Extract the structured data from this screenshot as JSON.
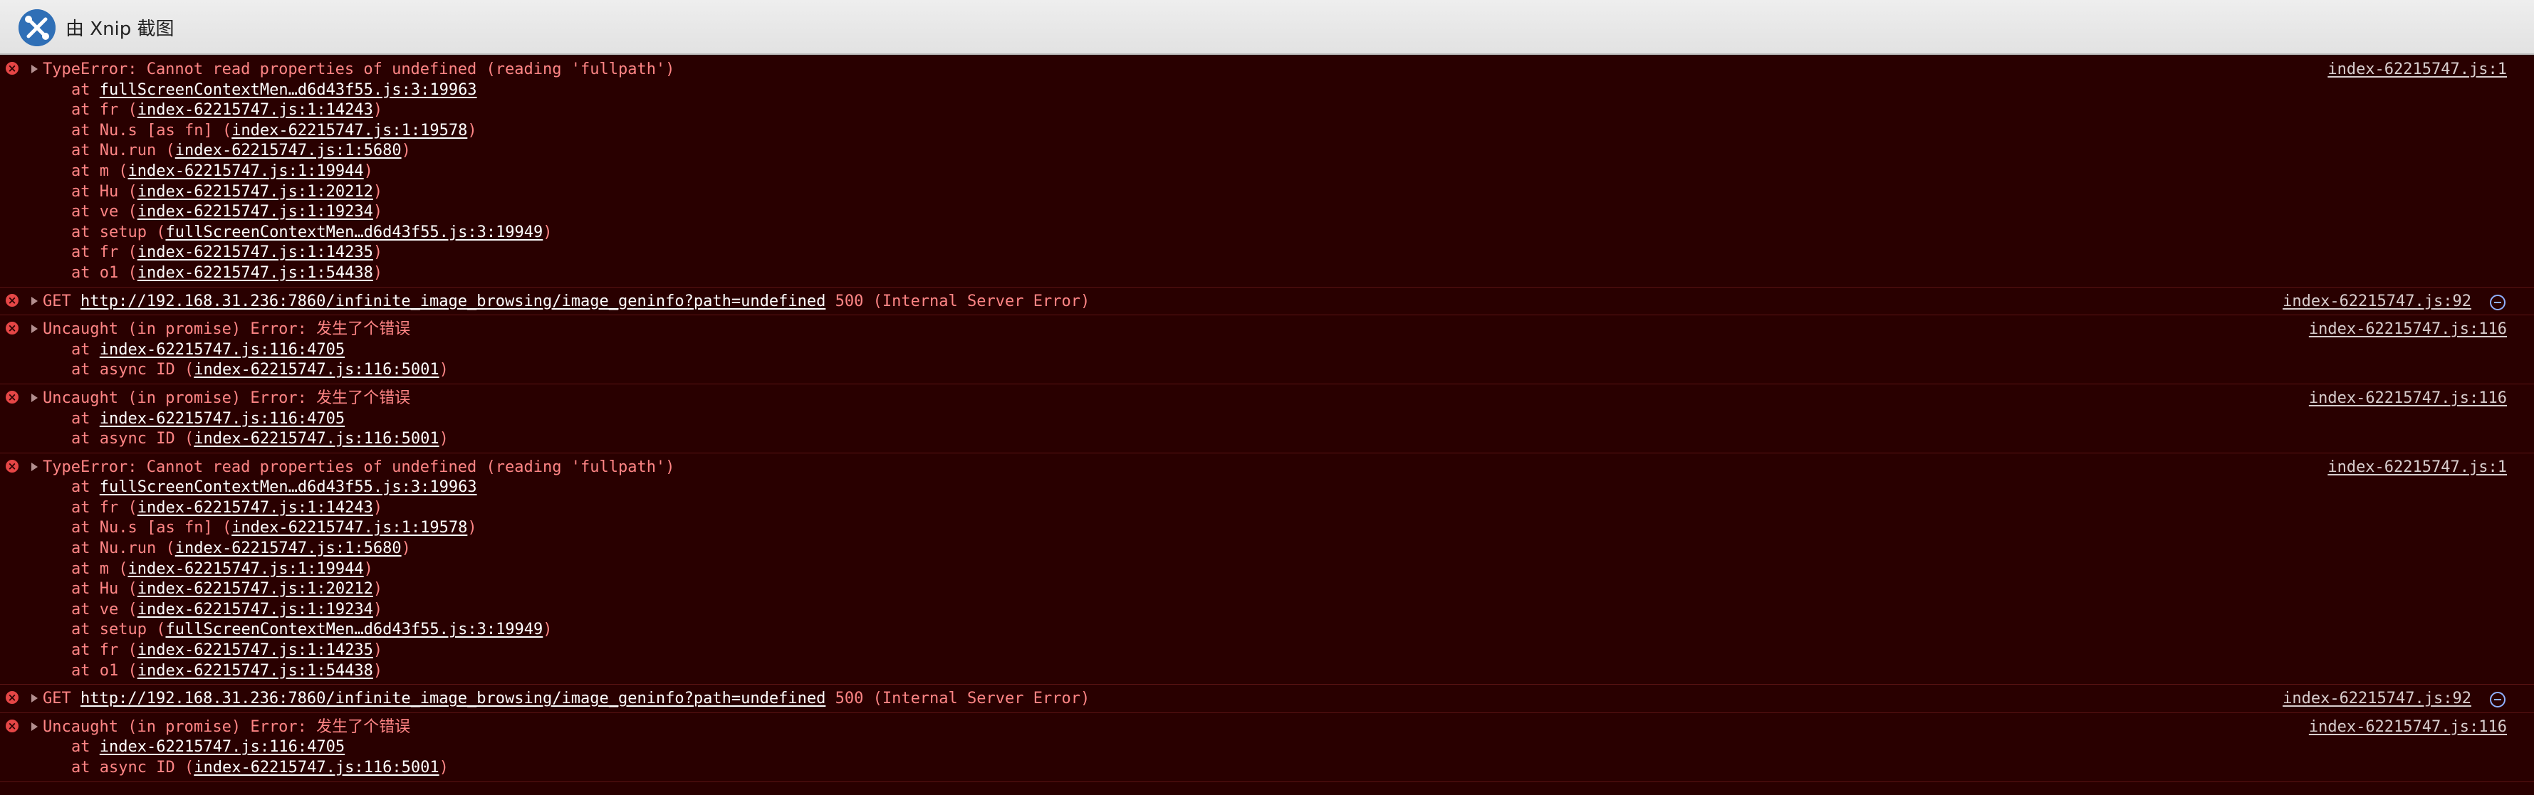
{
  "window": {
    "title": "由 Xnip 截图",
    "app_icon": "xnip-logo-icon"
  },
  "colors": {
    "background": "#290000",
    "error_text": "#ff8585",
    "link_text": "#ffffff",
    "source_link": "#d9cece",
    "error_icon": "#e54646"
  },
  "messages": [
    {
      "type": "type-error",
      "text": "TypeError: Cannot read properties of undefined (reading 'fullpath')",
      "source": "index-62215747.js:1",
      "frames": [
        {
          "prefix": "at ",
          "name": "",
          "open": "",
          "link": "fullScreenContextMen…d6d43f55.js:3:19963",
          "close": ""
        },
        {
          "prefix": "at ",
          "name": "fr ",
          "open": "(",
          "link": "index-62215747.js:1:14243",
          "close": ")"
        },
        {
          "prefix": "at ",
          "name": "Nu.s [as fn] ",
          "open": "(",
          "link": "index-62215747.js:1:19578",
          "close": ")"
        },
        {
          "prefix": "at ",
          "name": "Nu.run ",
          "open": "(",
          "link": "index-62215747.js:1:5680",
          "close": ")"
        },
        {
          "prefix": "at ",
          "name": "m ",
          "open": "(",
          "link": "index-62215747.js:1:19944",
          "close": ")"
        },
        {
          "prefix": "at ",
          "name": "Hu ",
          "open": "(",
          "link": "index-62215747.js:1:20212",
          "close": ")"
        },
        {
          "prefix": "at ",
          "name": "ve ",
          "open": "(",
          "link": "index-62215747.js:1:19234",
          "close": ")"
        },
        {
          "prefix": "at ",
          "name": "setup ",
          "open": "(",
          "link": "fullScreenContextMen…d6d43f55.js:3:19949",
          "close": ")"
        },
        {
          "prefix": "at ",
          "name": "fr ",
          "open": "(",
          "link": "index-62215747.js:1:14235",
          "close": ")"
        },
        {
          "prefix": "at ",
          "name": "o1 ",
          "open": "(",
          "link": "index-62215747.js:1:54438",
          "close": ")"
        }
      ]
    },
    {
      "type": "network-error",
      "method": "GET ",
      "url": "http://192.168.31.236:7860/infinite_image_browsing/image_geninfo?path=undefined",
      "status": " 500 (Internal Server Error)",
      "source": "index-62215747.js:92"
    },
    {
      "type": "promise-error",
      "text": "Uncaught (in promise) Error: 发生了个错误",
      "source": "index-62215747.js:116",
      "frames": [
        {
          "prefix": "at ",
          "name": "",
          "open": "",
          "link": "index-62215747.js:116:4705",
          "close": ""
        },
        {
          "prefix": "at ",
          "name": "async ID ",
          "open": "(",
          "link": "index-62215747.js:116:5001",
          "close": ")"
        }
      ]
    },
    {
      "type": "promise-error",
      "text": "Uncaught (in promise) Error: 发生了个错误",
      "source": "index-62215747.js:116",
      "frames": [
        {
          "prefix": "at ",
          "name": "",
          "open": "",
          "link": "index-62215747.js:116:4705",
          "close": ""
        },
        {
          "prefix": "at ",
          "name": "async ID ",
          "open": "(",
          "link": "index-62215747.js:116:5001",
          "close": ")"
        }
      ]
    },
    {
      "type": "type-error",
      "text": "TypeError: Cannot read properties of undefined (reading 'fullpath')",
      "source": "index-62215747.js:1",
      "frames": [
        {
          "prefix": "at ",
          "name": "",
          "open": "",
          "link": "fullScreenContextMen…d6d43f55.js:3:19963",
          "close": ""
        },
        {
          "prefix": "at ",
          "name": "fr ",
          "open": "(",
          "link": "index-62215747.js:1:14243",
          "close": ")"
        },
        {
          "prefix": "at ",
          "name": "Nu.s [as fn] ",
          "open": "(",
          "link": "index-62215747.js:1:19578",
          "close": ")"
        },
        {
          "prefix": "at ",
          "name": "Nu.run ",
          "open": "(",
          "link": "index-62215747.js:1:5680",
          "close": ")"
        },
        {
          "prefix": "at ",
          "name": "m ",
          "open": "(",
          "link": "index-62215747.js:1:19944",
          "close": ")"
        },
        {
          "prefix": "at ",
          "name": "Hu ",
          "open": "(",
          "link": "index-62215747.js:1:20212",
          "close": ")"
        },
        {
          "prefix": "at ",
          "name": "ve ",
          "open": "(",
          "link": "index-62215747.js:1:19234",
          "close": ")"
        },
        {
          "prefix": "at ",
          "name": "setup ",
          "open": "(",
          "link": "fullScreenContextMen…d6d43f55.js:3:19949",
          "close": ")"
        },
        {
          "prefix": "at ",
          "name": "fr ",
          "open": "(",
          "link": "index-62215747.js:1:14235",
          "close": ")"
        },
        {
          "prefix": "at ",
          "name": "o1 ",
          "open": "(",
          "link": "index-62215747.js:1:54438",
          "close": ")"
        }
      ]
    },
    {
      "type": "network-error",
      "method": "GET ",
      "url": "http://192.168.31.236:7860/infinite_image_browsing/image_geninfo?path=undefined",
      "status": " 500 (Internal Server Error)",
      "source": "index-62215747.js:92"
    },
    {
      "type": "promise-error",
      "text": "Uncaught (in promise) Error: 发生了个错误",
      "source": "index-62215747.js:116",
      "frames": [
        {
          "prefix": "at ",
          "name": "",
          "open": "",
          "link": "index-62215747.js:116:4705",
          "close": ""
        },
        {
          "prefix": "at ",
          "name": "async ID ",
          "open": "(",
          "link": "index-62215747.js:116:5001",
          "close": ")"
        }
      ]
    }
  ]
}
